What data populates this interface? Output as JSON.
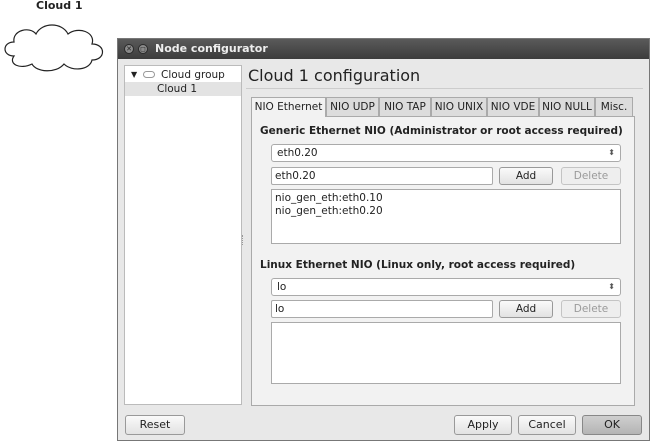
{
  "canvas": {
    "node_label": "Cloud 1"
  },
  "window": {
    "title": "Node configurator",
    "close_glyph": "✕",
    "maximize_glyph": "◻"
  },
  "tree": {
    "group_label": "Cloud group",
    "expand_glyph": "▼",
    "items": [
      {
        "label": "Cloud 1"
      }
    ]
  },
  "main": {
    "title": "Cloud 1 configuration",
    "tabs": [
      {
        "label": "NIO Ethernet",
        "active": true
      },
      {
        "label": "NIO UDP"
      },
      {
        "label": "NIO TAP"
      },
      {
        "label": "NIO UNIX"
      },
      {
        "label": "NIO VDE"
      },
      {
        "label": "NIO NULL"
      },
      {
        "label": "Misc."
      }
    ]
  },
  "generic": {
    "section_title": "Generic Ethernet NIO (Administrator or root access required)",
    "combo_value": "eth0.20",
    "field_value": "eth0.20",
    "add_label": "Add",
    "delete_label": "Delete",
    "list": [
      "nio_gen_eth:eth0.10",
      "nio_gen_eth:eth0.20"
    ]
  },
  "linux": {
    "section_title": "Linux Ethernet NIO (Linux only, root access required)",
    "combo_value": "lo",
    "field_value": "lo",
    "add_label": "Add",
    "delete_label": "Delete",
    "list": []
  },
  "footer": {
    "reset_label": "Reset",
    "apply_label": "Apply",
    "cancel_label": "Cancel",
    "ok_label": "OK"
  },
  "icons": {
    "combo_arrow": "⬍",
    "cloud": "cloud-icon"
  }
}
